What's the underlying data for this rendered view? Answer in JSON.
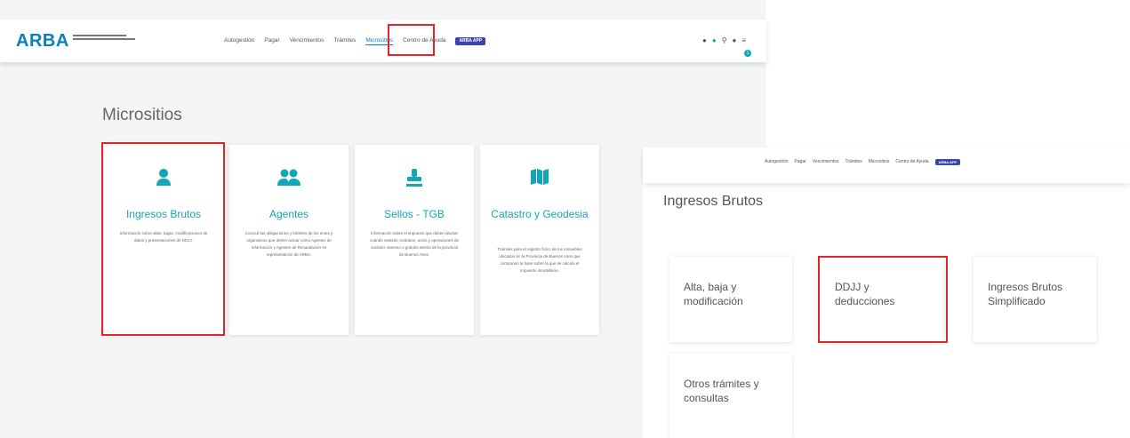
{
  "left": {
    "logo": "ARBA",
    "nav": [
      "Autogestión",
      "Pagar",
      "Vencimientos",
      "Trámites",
      "Micrositios",
      "Centro de Ayuda"
    ],
    "nav_active": "Micrositios",
    "nav_badge": "ARBA APP",
    "page_title": "Micrositios",
    "cards": [
      {
        "title": "Ingresos Brutos",
        "desc": "Información sobre altas, bajas, modificaciones de datos y presentaciones de DDJJ.",
        "icon": "user-icon"
      },
      {
        "title": "Agentes",
        "desc": "Conocé las obligaciones y trámites de los entes y organismos que deben actuar como Agentes de Información y Agentes de Recaudación en representación de ARBA.",
        "icon": "users-icon"
      },
      {
        "title": "Sellos - TGB",
        "desc": "Información sobre el impuesto que deben abonar cuando realizás contratos, actos y operaciones de carácter oneroso o gratuito dentro de la provincia de Buenos Aires.",
        "icon": "stamp-icon"
      },
      {
        "title": "Catastro y Geodesia",
        "desc": "Trámites para el registro físico de los inmuebles ubicados en la Provincia de Buenos Aires que componen la base sobre la que se calcula el impuesto inmobiliario.",
        "icon": "map-icon"
      }
    ]
  },
  "right": {
    "nav": [
      "Autogestión",
      "Pagar",
      "Vencimientos",
      "Trámites",
      "Micrositios",
      "Centro de Ayuda"
    ],
    "nav_badge": "ARBA APP",
    "page_title": "Ingresos Brutos",
    "cards": [
      "Alta, baja y modificación",
      "DDJJ y deducciones",
      "Ingresos Brutos Simplificado",
      "Otros trámites y consultas"
    ]
  },
  "colors": {
    "accent": "#13a6b6",
    "brand": "#0c7fb8",
    "highlight": "#e0252d",
    "badge": "#3a47a8"
  }
}
